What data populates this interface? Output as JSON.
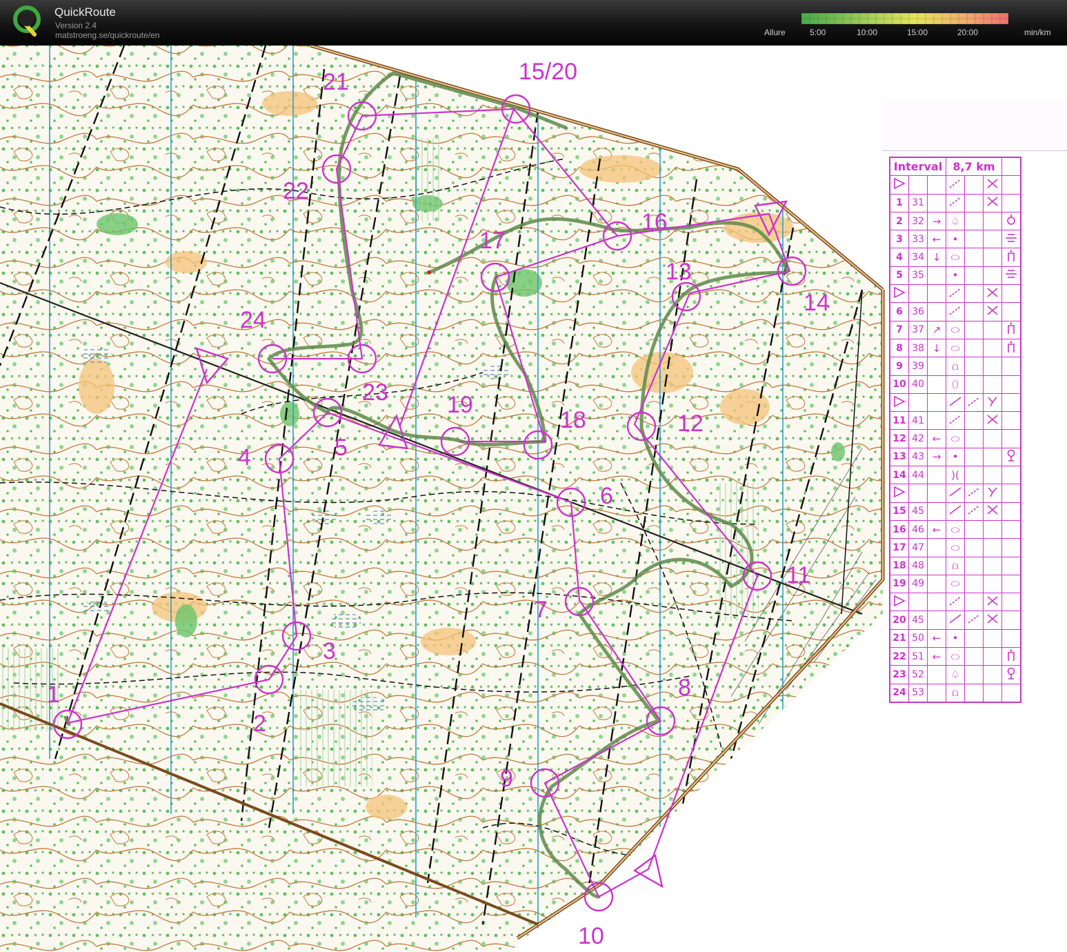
{
  "app": {
    "title": "QuickRoute",
    "version": "Version 2.4",
    "url": "matstroeng.se/quickroute/en"
  },
  "pace_scale": {
    "label": "Allure",
    "ticks": [
      "5:00",
      "10:00",
      "15:00",
      "20:00"
    ],
    "unit": "min/km",
    "gradient_colors": [
      "#4aa84a",
      "#9ccc5c",
      "#e6e65c",
      "#f0b070",
      "#f07070"
    ]
  },
  "course": {
    "header": {
      "name": "Interval",
      "length": "8,7 km"
    },
    "rows": [
      {
        "num": "",
        "code": "",
        "dir": "",
        "feat": "",
        "sym": "start"
      },
      {
        "num": "1",
        "code": "31",
        "dir": "",
        "feat": "",
        "sym": "cross"
      },
      {
        "num": "2",
        "code": "32",
        "dir": "→",
        "feat": "♤",
        "sym": "foot"
      },
      {
        "num": "3",
        "code": "33",
        "dir": "←",
        "feat": "•",
        "sym": "bar"
      },
      {
        "num": "4",
        "code": "34",
        "dir": "↓",
        "feat": "⬭",
        "sym": "mark"
      },
      {
        "num": "5",
        "code": "35",
        "dir": "",
        "feat": "•",
        "sym": "bar"
      },
      {
        "num": "",
        "code": "",
        "dir": "",
        "feat": "",
        "sym": "start"
      },
      {
        "num": "6",
        "code": "36",
        "dir": "",
        "feat": "",
        "sym": "cross"
      },
      {
        "num": "7",
        "code": "37",
        "dir": "↗",
        "feat": "⬭",
        "sym": "mark"
      },
      {
        "num": "8",
        "code": "38",
        "dir": "↓",
        "feat": "⬭",
        "sym": "mark"
      },
      {
        "num": "9",
        "code": "39",
        "dir": "",
        "feat": "⩍",
        "sym": ""
      },
      {
        "num": "10",
        "code": "40",
        "dir": "",
        "feat": "⬯",
        "sym": ""
      },
      {
        "num": "",
        "code": "",
        "dir": "",
        "feat": "",
        "sym": "start2"
      },
      {
        "num": "11",
        "code": "41",
        "dir": "",
        "feat": "",
        "sym": "cross"
      },
      {
        "num": "12",
        "code": "42",
        "dir": "←",
        "feat": "⬭",
        "sym": ""
      },
      {
        "num": "13",
        "code": "43",
        "dir": "→",
        "feat": "•",
        "sym": "pin"
      },
      {
        "num": "14",
        "code": "44",
        "dir": "",
        "feat": ")(",
        "sym": ""
      },
      {
        "num": "",
        "code": "",
        "dir": "",
        "feat": "",
        "sym": "start2"
      },
      {
        "num": "15",
        "code": "45",
        "dir": "",
        "feat": "",
        "sym": "cross2"
      },
      {
        "num": "16",
        "code": "46",
        "dir": "←",
        "feat": "⬭",
        "sym": ""
      },
      {
        "num": "17",
        "code": "47",
        "dir": "",
        "feat": "⬭",
        "sym": ""
      },
      {
        "num": "18",
        "code": "48",
        "dir": "",
        "feat": "⩍",
        "sym": ""
      },
      {
        "num": "19",
        "code": "49",
        "dir": "",
        "feat": "⬭",
        "sym": ""
      },
      {
        "num": "",
        "code": "",
        "dir": "",
        "feat": "",
        "sym": "start"
      },
      {
        "num": "20",
        "code": "45",
        "dir": "",
        "feat": "",
        "sym": "cross2"
      },
      {
        "num": "21",
        "code": "50",
        "dir": "←",
        "feat": "•",
        "sym": ""
      },
      {
        "num": "22",
        "code": "51",
        "dir": "←",
        "feat": "⬭",
        "sym": "mark"
      },
      {
        "num": "23",
        "code": "52",
        "dir": "",
        "feat": "♤",
        "sym": "pin"
      },
      {
        "num": "24",
        "code": "53",
        "dir": "",
        "feat": "⩍",
        "sym": ""
      }
    ]
  },
  "map_labels": [
    "1",
    "2",
    "3",
    "4",
    "5",
    "6",
    "7",
    "8",
    "9",
    "10",
    "11",
    "12",
    "13",
    "14",
    "15/20",
    "16",
    "17",
    "18",
    "19",
    "21",
    "22",
    "23",
    "24"
  ],
  "colors": {
    "course": "#cc33cc",
    "route": "#5e8a4a",
    "contour": "#b5651d",
    "vegetation": "#5cc05c",
    "open_land": "#f5c37a",
    "north_line": "#2aa0c8"
  }
}
